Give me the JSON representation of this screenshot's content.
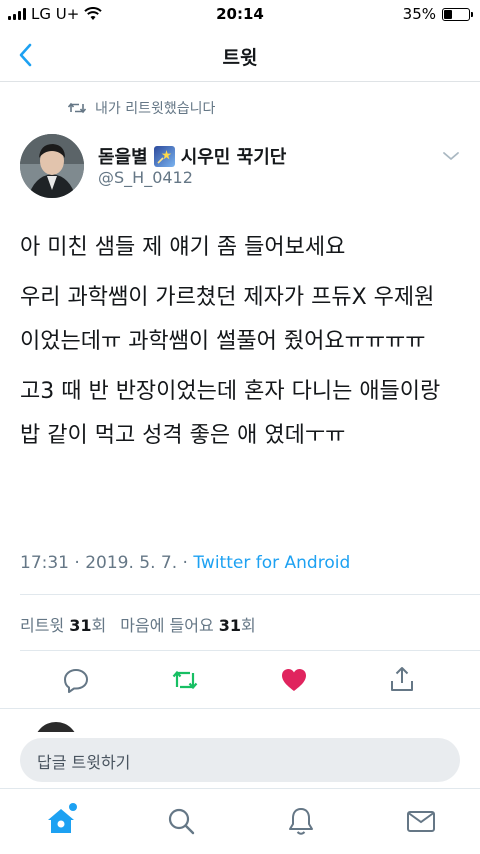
{
  "status_bar": {
    "carrier": "LG U+",
    "time": "20:14",
    "battery": "35%",
    "battery_level": 0.35
  },
  "nav": {
    "title": "트윗",
    "back_icon": "chevron-left-icon"
  },
  "retweet_context": {
    "text": "내가 리트윗했습니다",
    "icon": "retweet-icon"
  },
  "author": {
    "name_prefix": "돋을별",
    "name_suffix": "시우민 꾹기단",
    "handle": "@S_H_0412",
    "badge_icon": "shooting-star-emoji"
  },
  "tweet": {
    "paragraphs": [
      "아 미친 샘들 제 얘기 좀 들어보세요",
      "우리 과학쌤이 가르쳤던 제자가 프듀X 우제원 이었는데ㅠ 과학쌤이 썰풀어 줬어요ㅠㅠㅠㅠ",
      "고3 때 반 반장이었는데 혼자 다니는 애들이랑 밥 같이 먹고 성격 좋은 애 였데ㅜㅠ"
    ],
    "timestamp": "17:31 · 2019. 5. 7. · ",
    "client": "Twitter for Android"
  },
  "stats": {
    "retweets_label": "리트윗",
    "retweets_count": "31",
    "retweets_unit": "회",
    "likes_label": "마음에 들어요",
    "likes_count": "31",
    "likes_unit": "회"
  },
  "actions": [
    "reply-icon",
    "retweet-icon",
    "like-icon",
    "share-icon"
  ],
  "reply": {
    "placeholder": "답글 트윗하기"
  },
  "tabs": [
    "home-icon",
    "search-icon",
    "notifications-icon",
    "messages-icon"
  ],
  "colors": {
    "accent": "#1da1f2",
    "retweet_green": "#17bf63",
    "like_red": "#e0245e",
    "secondary_text": "#657786"
  }
}
